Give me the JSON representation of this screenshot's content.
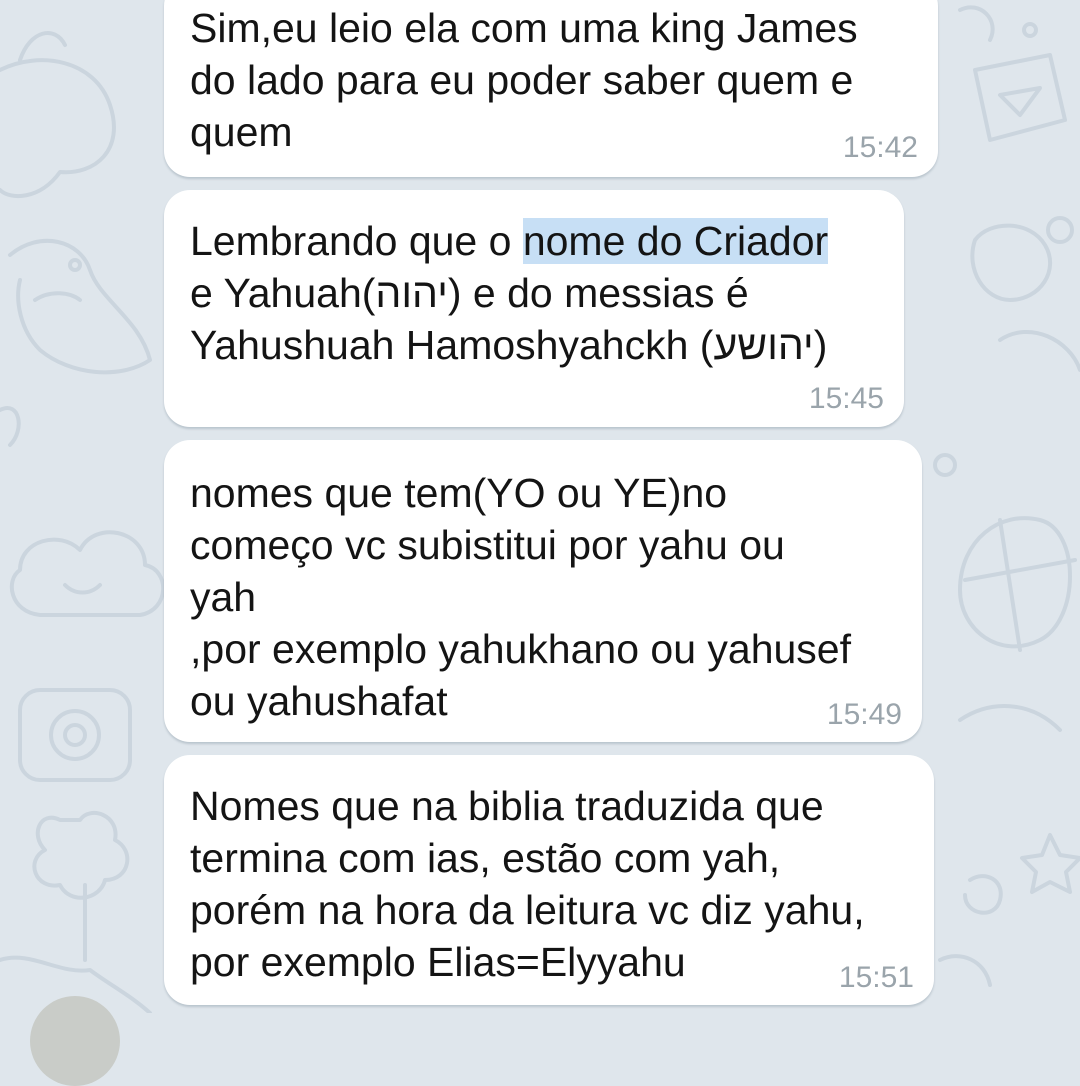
{
  "messages": [
    {
      "lines": [
        "Sim,eu leio ela com uma king James",
        "do lado para eu poder saber quem e",
        "quem"
      ],
      "time": "15:42"
    },
    {
      "line1_before": "Lembrando que o ",
      "line1_highlight": "nome do Criador",
      "line2": "e Yahuah(יהוה) e do messias é",
      "line3": "Yahushuah Hamoshyahckh (יהושע)",
      "time": "15:45"
    },
    {
      "lines": [
        "nomes que tem(YO ou YE)no",
        "começo vc subistitui por yahu ou",
        "yah",
        ",por exemplo yahukhano ou yahusef",
        "ou yahushafat"
      ],
      "time": "15:49"
    },
    {
      "lines": [
        "Nomes que na biblia traduzida que",
        "termina com ias, estão com yah,",
        "porém na hora da leitura vc diz yahu,",
        "por exemplo Elias=Elyyahu"
      ],
      "time": "15:51"
    }
  ],
  "colors": {
    "background": "#dfe6ec",
    "bubble": "#ffffff",
    "selection_highlight": "#c7dff5",
    "timestamp": "#9aa4ab",
    "text": "#141414"
  }
}
